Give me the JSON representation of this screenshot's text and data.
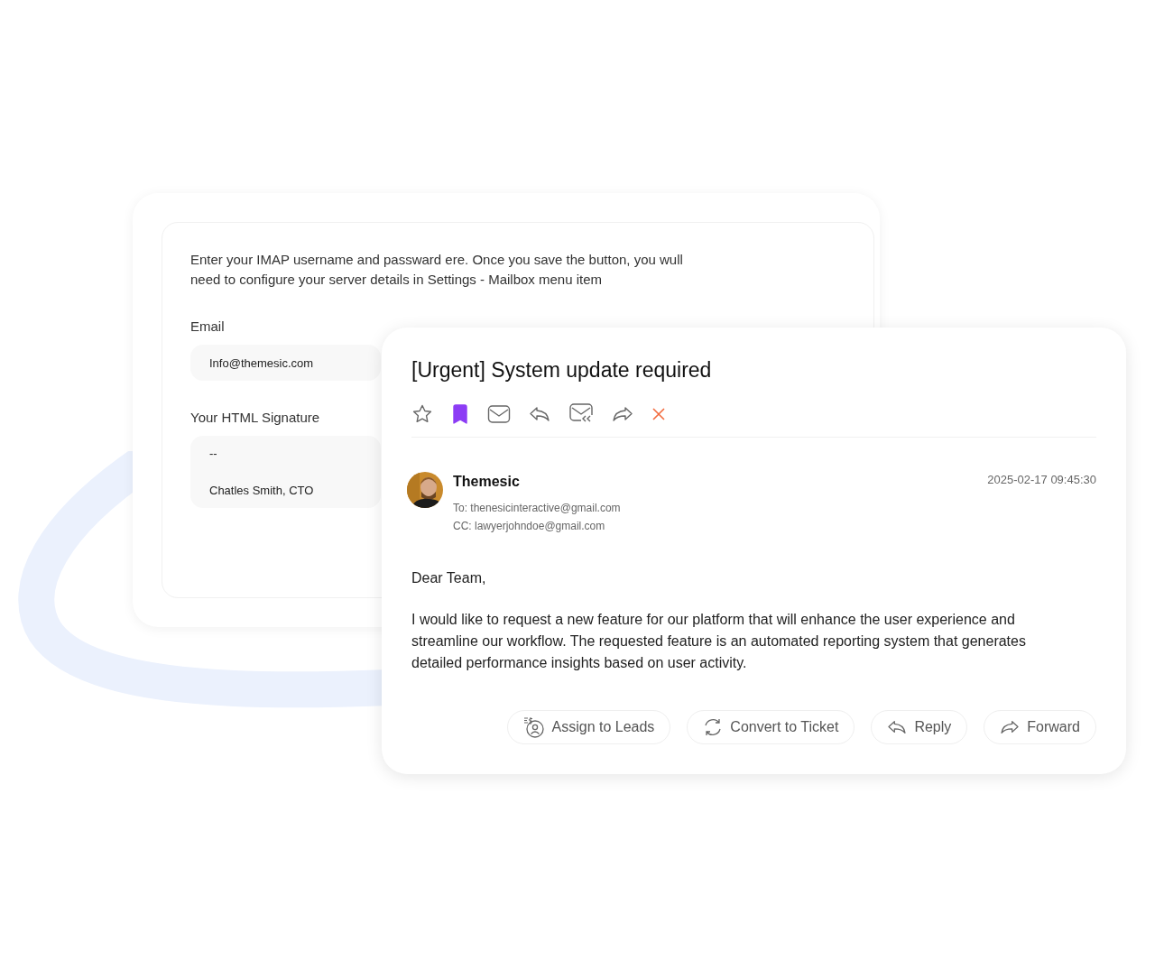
{
  "settings_card": {
    "intro": "Enter your IMAP username and passward ere. Once you save the button, you wull need to configure your server details in Settings - Mailbox menu item",
    "email": {
      "label": "Email",
      "value": "Info@themesic.com"
    },
    "signature": {
      "label": "Your HTML Signature",
      "lines": [
        "--",
        "Chatles Smith, CTO"
      ]
    }
  },
  "email_card": {
    "subject": "[Urgent] System update required",
    "toolbar": [
      {
        "kind": "star",
        "selected": false
      },
      {
        "kind": "bookmark",
        "selected": true
      },
      {
        "kind": "mail",
        "selected": false
      },
      {
        "kind": "reply",
        "selected": false
      },
      {
        "kind": "reply-all",
        "selected": false
      },
      {
        "kind": "forward",
        "selected": false
      },
      {
        "kind": "delete",
        "selected": false
      }
    ],
    "sender": {
      "name": "Themesic",
      "to": "To: thenesicinteractive@gmail.com",
      "cc": "CC: lawyerjohndoe@gmail.com",
      "date": "2025-02-17 09:45:30"
    },
    "body": [
      "Dear Team,",
      "I would like to request a new feature for our platform that will enhance the user experience and streamline our workflow. The requested feature is an automated reporting system that generates detailed performance insights based on user activity."
    ],
    "actions": [
      {
        "kind": "assign",
        "label": "Assign to Leads"
      },
      {
        "kind": "convert",
        "label": "Convert to Ticket"
      },
      {
        "kind": "reply",
        "label": "Reply"
      },
      {
        "kind": "forward",
        "label": "Forward"
      }
    ]
  }
}
